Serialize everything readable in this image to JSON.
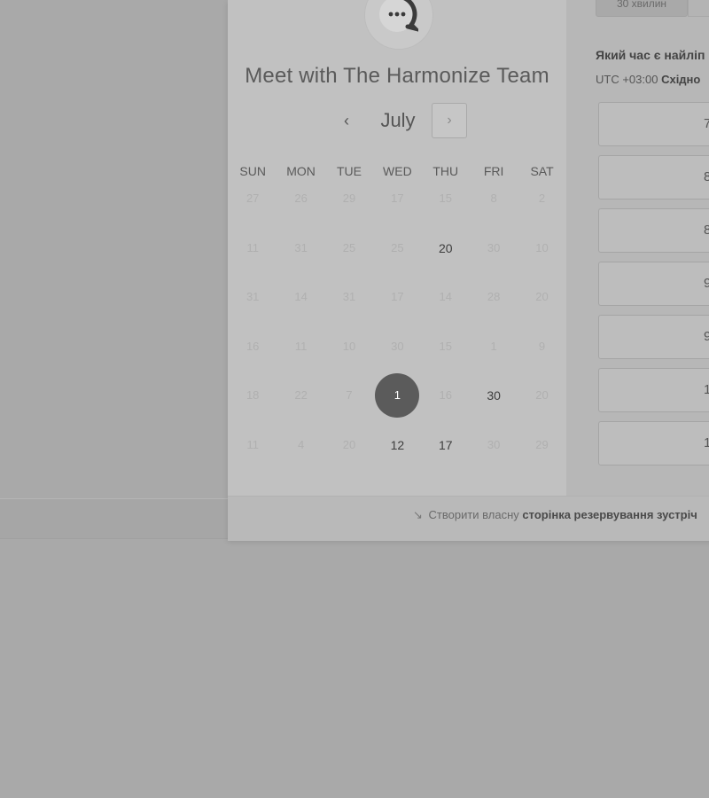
{
  "widget": {
    "title": "Meet with The Harmonize Team",
    "avatar": {
      "icon": "chat-bubble-logo"
    }
  },
  "calendar": {
    "month": "July",
    "prev_icon": "‹",
    "next_icon": "›",
    "weekdays": [
      "SUN",
      "MON",
      "TUE",
      "WED",
      "THU",
      "FRI",
      "SAT"
    ],
    "weeks": [
      [
        "27",
        "26",
        "29",
        "17",
        "15",
        "8",
        "2"
      ],
      [
        "11",
        "31",
        "25",
        "25",
        "20",
        "30",
        "10"
      ],
      [
        "31",
        "14",
        "31",
        "17",
        "14",
        "28",
        "20"
      ],
      [
        "16",
        "11",
        "10",
        "30",
        "15",
        "1",
        "9"
      ],
      [
        "18",
        "22",
        "7",
        "1",
        "16",
        "30",
        "20"
      ],
      [
        "11",
        "4",
        "20",
        "12",
        "17",
        "30",
        "29"
      ]
    ],
    "available_cells": [
      "1-4",
      "4-5",
      "5-3",
      "5-4"
    ],
    "selected_cell": "4-3"
  },
  "booking": {
    "duration_tab": "30 хвилин",
    "question": "Який час є найліп",
    "timezone_prefix": "UTC +03:00",
    "timezone_name": "Східно",
    "slots": [
      "7",
      "8",
      "8",
      "9",
      "9",
      "1",
      "1"
    ]
  },
  "footer": {
    "icon": "↘",
    "text_prefix": "Створити власну",
    "text_bold": "сторінка резервування зустріч"
  },
  "colors": {
    "background": "#a9a9a9",
    "selected_day": "#5b5b5b",
    "panel": "#c1c1c1"
  }
}
